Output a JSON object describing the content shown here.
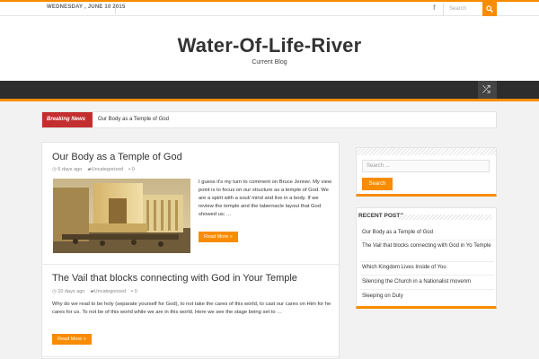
{
  "topbar": {
    "date": "WEDNESDAY , JUNE 10 2015",
    "facebook_icon": "facebook-icon",
    "search_placeholder": "Search",
    "search_icon": "search-icon"
  },
  "header": {
    "title": "Water-Of-Life-River",
    "description": "Current Blog"
  },
  "nav": {
    "random_icon": "shuffle-icon"
  },
  "breaking": {
    "label": "Breaking News",
    "headline": "Our Body as a Temple of God"
  },
  "posts": [
    {
      "title": "Our Body as a Temple of God",
      "date": "6 days ago",
      "category": "Uncategorized",
      "comments": "0",
      "excerpt": "I guess it's my turn to comment on Bruce Jenner. My view point is to focus on our structure as a temple of God. We are a spirit with a soul/ mind and live in a body. If we review the temple and the tabernacle layout that God showed us; …",
      "more": "Read More »"
    },
    {
      "title": "The Vail that blocks connecting with God in Your Temple",
      "date": "10 days ago",
      "category": "Uncategorized",
      "comments": "0",
      "excerpt": "Why do we read to be holy (separate yourself for God), to not take the cares of this world, to cast our cares on Him for he cares for us. To not be of this world while we are in this world. Here we see the stage being set to …",
      "more": "Read More »"
    }
  ],
  "sidebar": {
    "search_placeholder": "Search ...",
    "search_button": "Search",
    "recent_title": "Recent Posts",
    "recent_posts": [
      "Our Body as a Temple of God",
      "The Vail that blocks connecting with God in Yo Temple",
      "Which Kingdom Lives Inside of You",
      "Silencing the Church in a Nationalist movenm",
      "Sleeping on Duty"
    ]
  },
  "colors": {
    "accent": "#f88c00",
    "breaking": "#c32f2f",
    "nav": "#2d2d2d"
  }
}
